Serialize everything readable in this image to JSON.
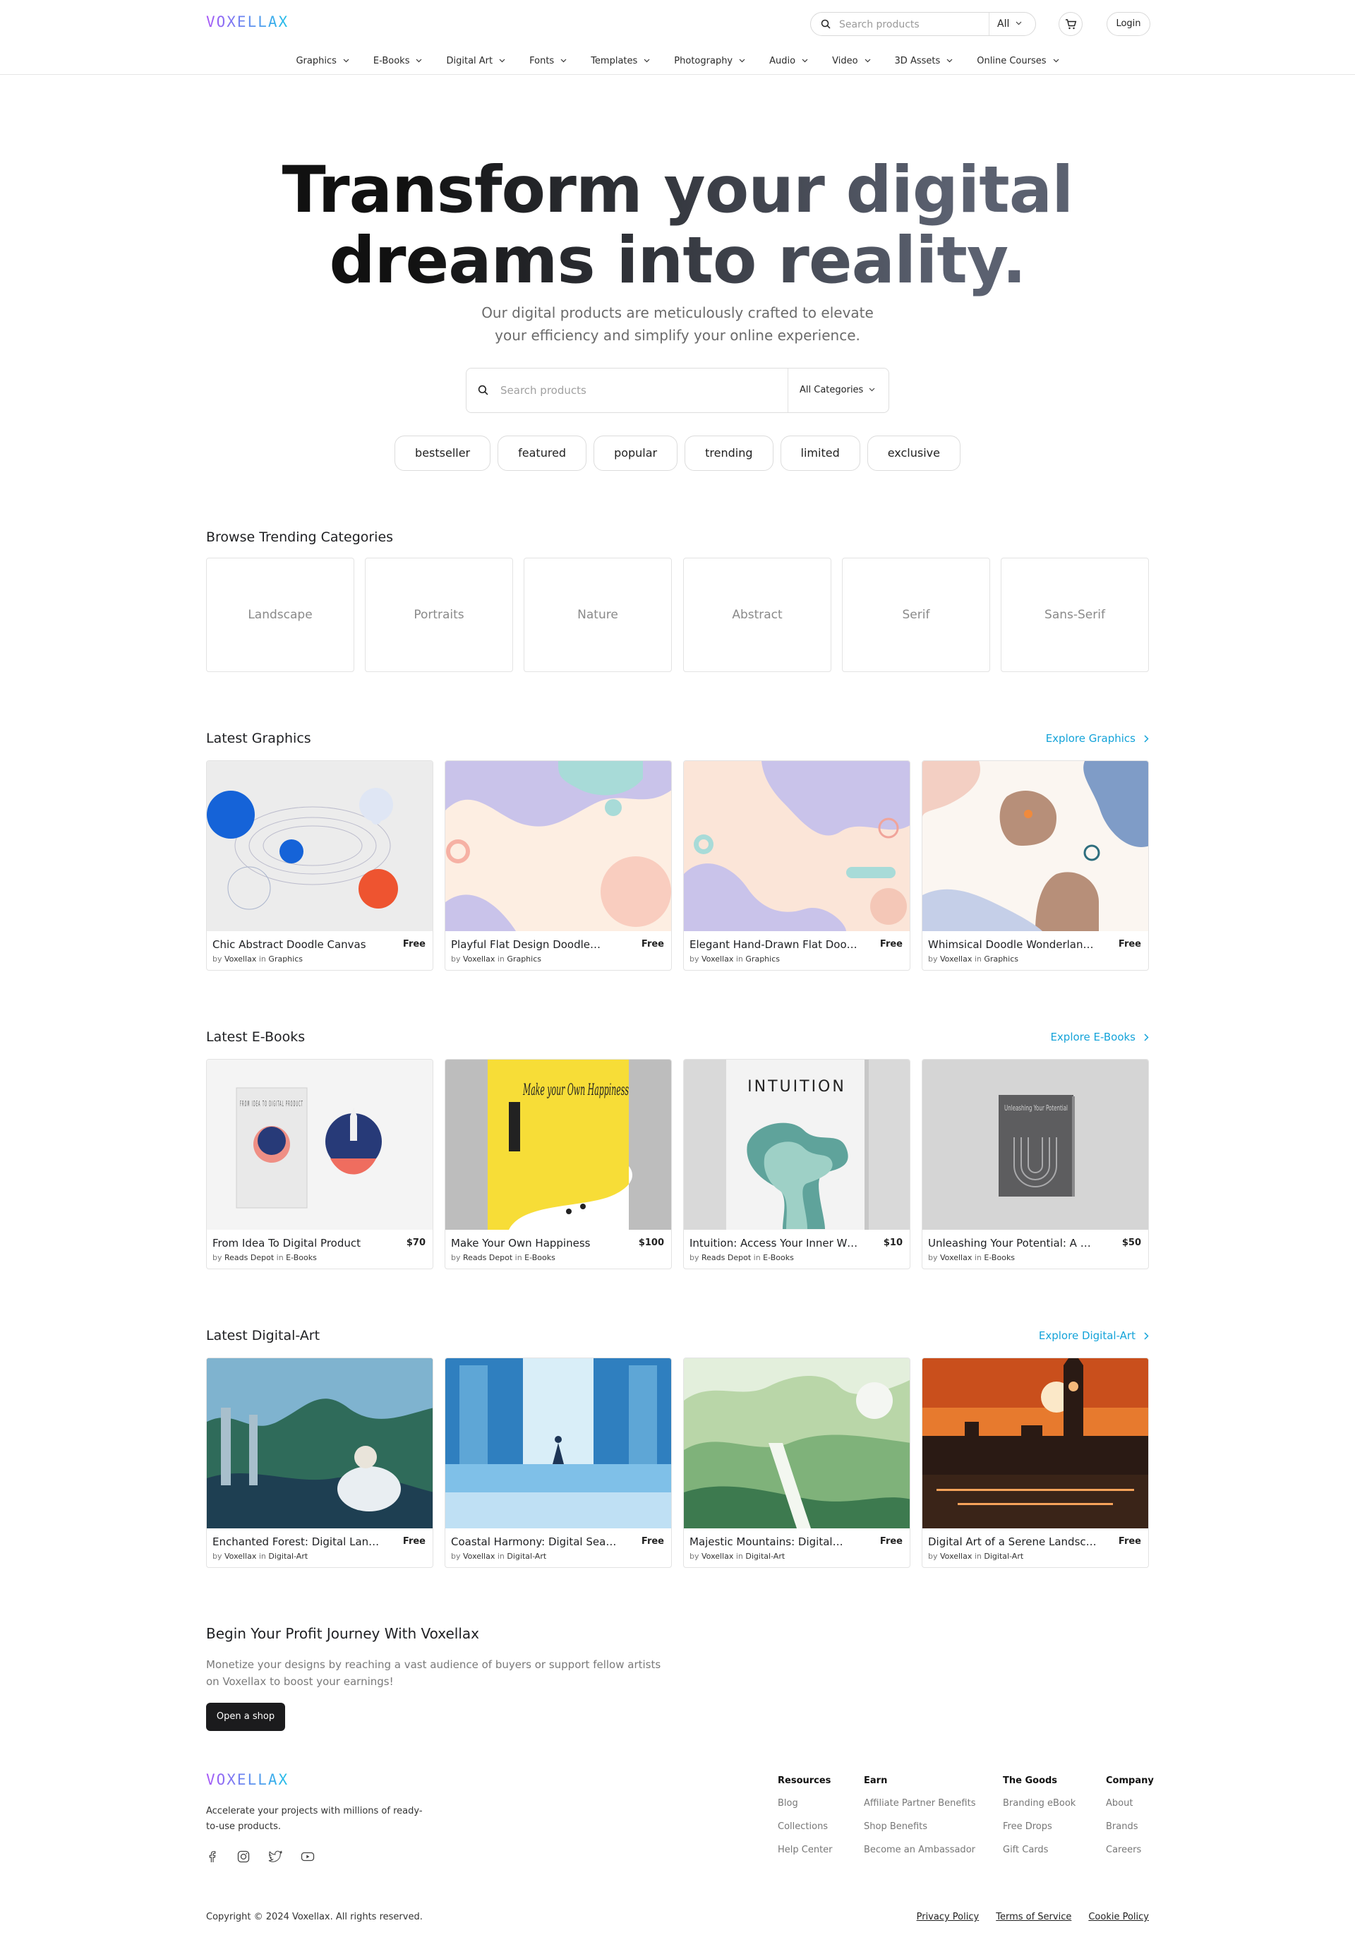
{
  "brand": {
    "logo_text": "VOXELLAX"
  },
  "header": {
    "search_placeholder": "Search products",
    "search_scope": "All",
    "login_label": "Login"
  },
  "nav": [
    "Graphics",
    "E-Books",
    "Digital Art",
    "Fonts",
    "Templates",
    "Photography",
    "Audio",
    "Video",
    "3D Assets",
    "Online Courses"
  ],
  "hero": {
    "title_line1": "Transform your digital",
    "title_line2": "dreams into reality.",
    "subtitle": "Our digital products are meticulously crafted to elevate your efficiency and simplify your online experience.",
    "search_placeholder": "Search products",
    "category_select": "All Categories",
    "tags": [
      "bestseller",
      "featured",
      "popular",
      "trending",
      "limited",
      "exclusive"
    ]
  },
  "trending": {
    "title": "Browse Trending Categories",
    "items": [
      "Landscape",
      "Portraits",
      "Nature",
      "Abstract",
      "Serif",
      "Sans-Serif"
    ]
  },
  "sections": [
    {
      "title": "Latest Graphics",
      "explore_label": "Explore Graphics",
      "products": [
        {
          "name": "Chic Abstract Doodle Canvas",
          "price": "Free",
          "by": "by",
          "author": "Voxellax",
          "in": "in",
          "category": "Graphics"
        },
        {
          "name": "Playful Flat Design Doodle…",
          "price": "Free",
          "by": "by",
          "author": "Voxellax",
          "in": "in",
          "category": "Graphics"
        },
        {
          "name": "Elegant Hand-Drawn Flat Doodle…",
          "price": "Free",
          "by": "by",
          "author": "Voxellax",
          "in": "in",
          "category": "Graphics"
        },
        {
          "name": "Whimsical Doodle Wonderland…",
          "price": "Free",
          "by": "by",
          "author": "Voxellax",
          "in": "in",
          "category": "Graphics"
        }
      ]
    },
    {
      "title": "Latest E-Books",
      "explore_label": "Explore E-Books",
      "products": [
        {
          "name": "From Idea To Digital Product",
          "price": "$70",
          "by": "by",
          "author": "Reads Depot",
          "in": "in",
          "category": "E-Books"
        },
        {
          "name": "Make Your Own Happiness",
          "price": "$100",
          "by": "by",
          "author": "Reads Depot",
          "in": "in",
          "category": "E-Books"
        },
        {
          "name": "Intuition: Access Your Inner Wisdo…",
          "price": "$10",
          "by": "by",
          "author": "Reads Depot",
          "in": "in",
          "category": "E-Books"
        },
        {
          "name": "Unleashing Your Potential: A Guide…",
          "price": "$50",
          "by": "by",
          "author": "Voxellax",
          "in": "in",
          "category": "E-Books"
        }
      ]
    },
    {
      "title": "Latest Digital-Art",
      "explore_label": "Explore Digital-Art",
      "products": [
        {
          "name": "Enchanted Forest: Digital Landsca…",
          "price": "Free",
          "by": "by",
          "author": "Voxellax",
          "in": "in",
          "category": "Digital-Art"
        },
        {
          "name": "Coastal Harmony: Digital Seaside…",
          "price": "Free",
          "by": "by",
          "author": "Voxellax",
          "in": "in",
          "category": "Digital-Art"
        },
        {
          "name": "Majestic Mountains: Digital…",
          "price": "Free",
          "by": "by",
          "author": "Voxellax",
          "in": "in",
          "category": "Digital-Art"
        },
        {
          "name": "Digital Art of a Serene Landscape",
          "price": "Free",
          "by": "by",
          "author": "Voxellax",
          "in": "in",
          "category": "Digital-Art"
        }
      ]
    }
  ],
  "book_covers": {
    "idea": "FROM IDEA TO DIGITAL PRODUCT",
    "happiness": "Make your Own Happiness",
    "intuition": "INTUITION",
    "potential": "Unleashing Your Potential"
  },
  "profit": {
    "title": "Begin Your Profit Journey With Voxellax",
    "text": "Monetize your designs by reaching a vast audience of buyers or support fellow artists on Voxellax to boost your earnings!",
    "button_label": "Open a shop"
  },
  "footer": {
    "tagline": "Accelerate your projects with millions of ready-to-use products.",
    "columns": [
      {
        "title": "Resources",
        "links": [
          "Blog",
          "Collections",
          "Help Center"
        ]
      },
      {
        "title": "Earn",
        "links": [
          "Affiliate Partner Benefits",
          "Shop Benefits",
          "Become an Ambassador"
        ]
      },
      {
        "title": "The Goods",
        "links": [
          "Branding eBook",
          "Free Drops",
          "Gift Cards"
        ]
      },
      {
        "title": "Company",
        "links": [
          "About",
          "Brands",
          "Careers"
        ]
      }
    ],
    "copyright": "Copyright © 2024 Voxellax. All rights reserved.",
    "legal": [
      "Privacy Policy",
      "Terms of Service",
      "Cookie Policy"
    ],
    "socials": [
      "facebook-icon",
      "instagram-icon",
      "twitter-icon",
      "youtube-icon"
    ]
  },
  "colors": {
    "accent": "#14a3d9",
    "logo_from": "#a855f7",
    "logo_to": "#22c1e8",
    "dark_button": "#1b1b1d"
  }
}
